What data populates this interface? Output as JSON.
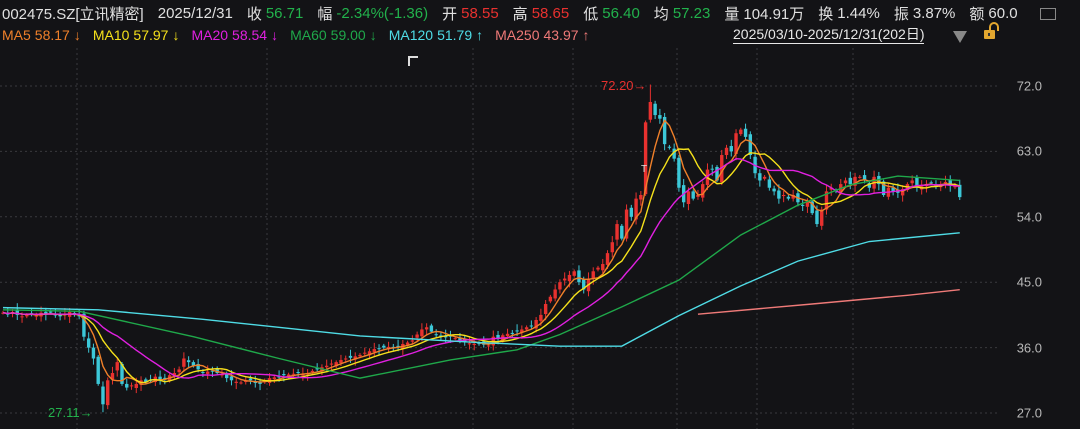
{
  "header": {
    "symbol": "002475.SZ[立讯精密]",
    "date": "2025/12/31",
    "close_label": "收",
    "close": "56.71",
    "change_label": "幅",
    "change": "-2.34%(-1.36)",
    "open_label": "开",
    "open": "58.55",
    "high_label": "高",
    "high": "58.65",
    "low_label": "低",
    "low": "56.40",
    "avg_label": "均",
    "avg": "57.23",
    "volume_label": "量",
    "volume": "104.91万",
    "turnover_label": "换",
    "turnover": "1.44%",
    "amplitude_label": "振",
    "amplitude": "3.87%",
    "amount_label": "额",
    "amount": "60.0"
  },
  "ma_legend": [
    {
      "label": "MA5",
      "value": "58.17",
      "arrow": "↓",
      "color": "#f0802a"
    },
    {
      "label": "MA10",
      "value": "57.97",
      "arrow": "↓",
      "color": "#f5e11b"
    },
    {
      "label": "MA20",
      "value": "58.54",
      "arrow": "↓",
      "color": "#e020e0"
    },
    {
      "label": "MA60",
      "value": "59.00",
      "arrow": "↓",
      "color": "#1fa84a"
    },
    {
      "label": "MA120",
      "value": "51.79",
      "arrow": "↑",
      "color": "#4fdce6"
    },
    {
      "label": "MA250",
      "value": "43.97",
      "arrow": "↑",
      "color": "#ef7a78"
    }
  ],
  "date_range": "2025/03/10-2025/12/31(202日)",
  "icons": [
    "dropdown-triangle-icon",
    "unlock-icon",
    "monitor-icon",
    "corner-bracket-icon"
  ],
  "chart_data": {
    "type": "candlestick",
    "up_color": "#e8312f",
    "down_color": "#3cc8d8",
    "y_ticks": [
      "72.0",
      "63.0",
      "54.0",
      "45.0",
      "36.0",
      "27.0"
    ],
    "ylim": [
      27,
      72
    ],
    "y_axis_position": "right",
    "grid": true,
    "max_label": "72.20",
    "min_label": "27.11",
    "max_index": 136,
    "min_index": 21,
    "closes": [
      40.8,
      40.6,
      40.9,
      40.5,
      40.3,
      40.5,
      40.7,
      40.4,
      40.8,
      40.6,
      40.8,
      40.5,
      40.3,
      40.6,
      40.9,
      40.5,
      40.3,
      37.5,
      36,
      34.5,
      31,
      28.2,
      31.5,
      32.5,
      34,
      31,
      30.5,
      30.8,
      31,
      31.5,
      31.2,
      31.5,
      32,
      31.6,
      31.8,
      32.2,
      32.5,
      33,
      34.5,
      34,
      33.5,
      33,
      32.5,
      32.7,
      32.8,
      32.5,
      32.3,
      31.8,
      31.5,
      31.3,
      31.2,
      31.4,
      31.5,
      31.2,
      31,
      31.5,
      31.8,
      31.9,
      32,
      32.2,
      32.3,
      32.4,
      32.5,
      32.4,
      32.5,
      32.8,
      33,
      33.3,
      33.5,
      33.8,
      34,
      34.3,
      34.5,
      34.6,
      34.8,
      35,
      35.3,
      35.5,
      35.8,
      35.9,
      36,
      36.1,
      36,
      36.2,
      36.5,
      36.7,
      37,
      37.8,
      38.5,
      38.8,
      38.2,
      37.8,
      37.5,
      37.4,
      37.5,
      37.3,
      37,
      36.8,
      36.6,
      36.5,
      36.5,
      36.4,
      36.3,
      37.5,
      37.3,
      37.7,
      37.9,
      38,
      38.3,
      38.5,
      38.8,
      39,
      39.8,
      40.5,
      42,
      43,
      44,
      45,
      45.5,
      46,
      46.5,
      45,
      44,
      45.5,
      46.5,
      47,
      47.5,
      49,
      50.5,
      53,
      51,
      55,
      54,
      56.5,
      57,
      67,
      69.8,
      68,
      67.5,
      64,
      63.5,
      62,
      58,
      56,
      57.5,
      56.5,
      57,
      58.5,
      60.5,
      60.5,
      59,
      62.5,
      63.5,
      63,
      65.5,
      66,
      65,
      62.5,
      60,
      59,
      59.5,
      58,
      57.5,
      56.5,
      57,
      56.5,
      57,
      56,
      55.5,
      56,
      54.5,
      53,
      55,
      57.5,
      58,
      57.5,
      58.5,
      59,
      58.5,
      59.5,
      59.5,
      59,
      58,
      59.5,
      58.5,
      57,
      58,
      57.5,
      57.3,
      57.8,
      58.5,
      59,
      58,
      58.2,
      58.5,
      58.7,
      58.2,
      58.5,
      58.8,
      58.3,
      58.4,
      56.71
    ],
    "long_ma": [
      {
        "name": "MA60",
        "color": "#1fa84a",
        "points": [
          [
            0,
            41.2
          ],
          [
            16,
            41
          ],
          [
            40,
            37.5
          ],
          [
            58,
            34.5
          ],
          [
            75,
            31.8
          ],
          [
            94,
            34.3
          ],
          [
            108,
            35.7
          ],
          [
            117,
            37.8
          ],
          [
            130,
            41.6
          ],
          [
            142,
            45.3
          ],
          [
            155,
            51.5
          ],
          [
            167,
            55.6
          ],
          [
            178,
            58.4
          ],
          [
            188,
            59.6
          ],
          [
            201,
            59.0
          ]
        ]
      },
      {
        "name": "MA120",
        "color": "#4fdce6",
        "points": [
          [
            0,
            41.5
          ],
          [
            20,
            41.2
          ],
          [
            42,
            39.9
          ],
          [
            75,
            37.6
          ],
          [
            100,
            36.7
          ],
          [
            117,
            36.2
          ],
          [
            130,
            36.2
          ],
          [
            142,
            40.4
          ],
          [
            155,
            44.5
          ],
          [
            167,
            47.9
          ],
          [
            182,
            50.6
          ],
          [
            201,
            51.79
          ]
        ]
      },
      {
        "name": "MA250",
        "color": "#ef7a78",
        "points": [
          [
            146,
            40.6
          ],
          [
            170,
            42.0
          ],
          [
            190,
            43.2
          ],
          [
            201,
            43.97
          ]
        ]
      }
    ]
  }
}
